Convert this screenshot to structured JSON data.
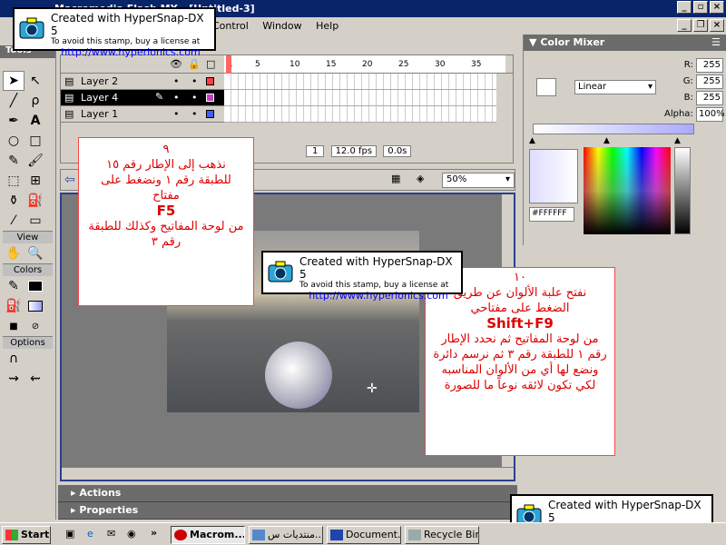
{
  "window": {
    "title": "Macromedia Flash MX - [Untitled-3]"
  },
  "menu": {
    "items": [
      "Control",
      "Window",
      "Help"
    ]
  },
  "tools": {
    "header": "Tools",
    "view_label": "View",
    "colors_label": "Colors",
    "options_label": "Options"
  },
  "timeline": {
    "ruler_ticks": [
      "1",
      "5",
      "10",
      "15",
      "20",
      "25",
      "30",
      "35"
    ],
    "layers": [
      {
        "name": "Layer 2",
        "color": "#ff4040"
      },
      {
        "name": "Layer 4",
        "color": "#c040c0"
      },
      {
        "name": "Layer 1",
        "color": "#4060ff"
      }
    ],
    "frame_number": "1",
    "fps": "12.0 fps",
    "elapsed": "0.0s"
  },
  "zoom": {
    "value": "50%"
  },
  "color_mixer": {
    "title": "Color Mixer",
    "fill_type": "Linear",
    "r_label": "R:",
    "r_value": "255",
    "g_label": "G:",
    "g_value": "255",
    "b_label": "B:",
    "b_value": "255",
    "alpha_label": "Alpha:",
    "alpha_value": "100%",
    "hex_value": "#FFFFFF"
  },
  "instruction_left": {
    "number": "٩",
    "line1": "نذهب إلى الإطار رقم ١٥",
    "line2": "للطبقة رقم ١ ونضغط على",
    "line3": "مفتاح",
    "key": "F5",
    "line4": "من لوحة المفاتيح وكذلك للطبقة",
    "line5": "رقم ٣"
  },
  "instruction_right": {
    "number": "١٠",
    "line1": "نفتح علبة الألوان عن طريق",
    "line2": "الضغط على مفتاحي",
    "key": "Shift+F9",
    "line3": "من لوحة المفاتيح ثم نحدد الإطار",
    "line4": "رقم ١ للطبقة رقم ٣ ثم نرسم دائرة",
    "line5": "ونضع لها أي من الألوان المناسبه",
    "line6": "لكي تكون لائقه نوعاً ما للصورة"
  },
  "stamp": {
    "line1": "Created with HyperSnap-DX 5",
    "line2": "To avoid this stamp, buy a license at",
    "url": "http://www.hyperionics.com"
  },
  "bottom_panels": {
    "actions": "Actions",
    "properties": "Properties"
  },
  "taskbar": {
    "start": "Start",
    "tasks": [
      "Macrom...",
      "منتديات س...",
      "Document...",
      "Recycle Bin"
    ]
  }
}
